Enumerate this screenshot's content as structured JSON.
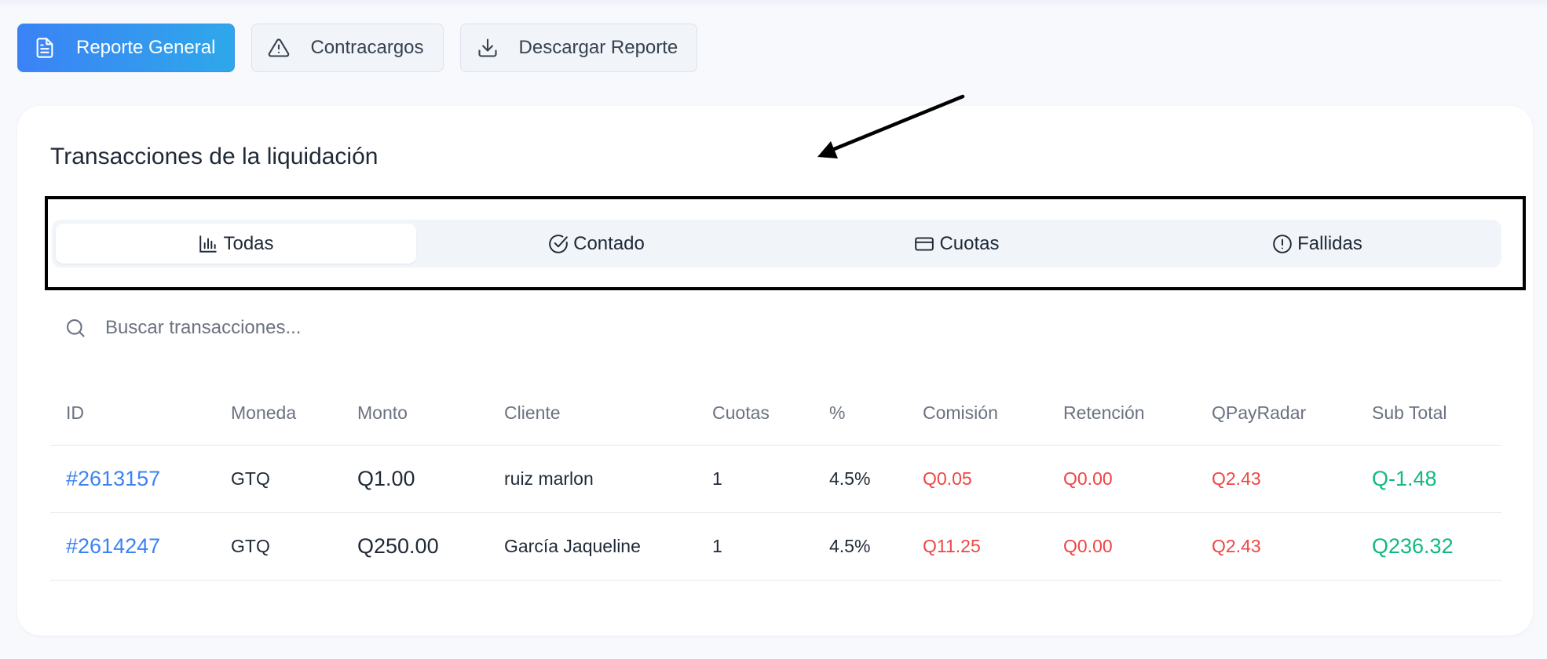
{
  "toolbar": {
    "buttons": [
      {
        "label": "Reporte General",
        "icon": "document-icon",
        "active": true
      },
      {
        "label": "Contracargos",
        "icon": "warning-icon",
        "active": false
      },
      {
        "label": "Descargar Reporte",
        "icon": "download-icon",
        "active": false
      }
    ]
  },
  "card": {
    "title": "Transacciones de la liquidación"
  },
  "tabs": [
    {
      "label": "Todas",
      "icon": "bar-chart-icon",
      "active": true
    },
    {
      "label": "Contado",
      "icon": "check-circle-icon",
      "active": false
    },
    {
      "label": "Cuotas",
      "icon": "credit-card-icon",
      "active": false
    },
    {
      "label": "Fallidas",
      "icon": "alert-circle-icon",
      "active": false
    }
  ],
  "search": {
    "placeholder": "Buscar transacciones..."
  },
  "table": {
    "columns": [
      "ID",
      "Moneda",
      "Monto",
      "Cliente",
      "Cuotas",
      "%",
      "Comisión",
      "Retención",
      "QPayRadar",
      "Sub Total"
    ],
    "rows": [
      [
        "#2613157",
        "GTQ",
        "Q1.00",
        "ruiz marlon",
        "1",
        "4.5%",
        "Q0.05",
        "Q0.00",
        "Q2.43",
        "Q-1.48"
      ],
      [
        "#2614247",
        "GTQ",
        "Q250.00",
        "García Jaqueline",
        "1",
        "4.5%",
        "Q11.25",
        "Q0.00",
        "Q2.43",
        "Q236.32"
      ]
    ]
  },
  "colors": {
    "primary": "#3b82f6",
    "negative": "#ef4444",
    "positive": "#10b981",
    "annotation": "#000000"
  }
}
